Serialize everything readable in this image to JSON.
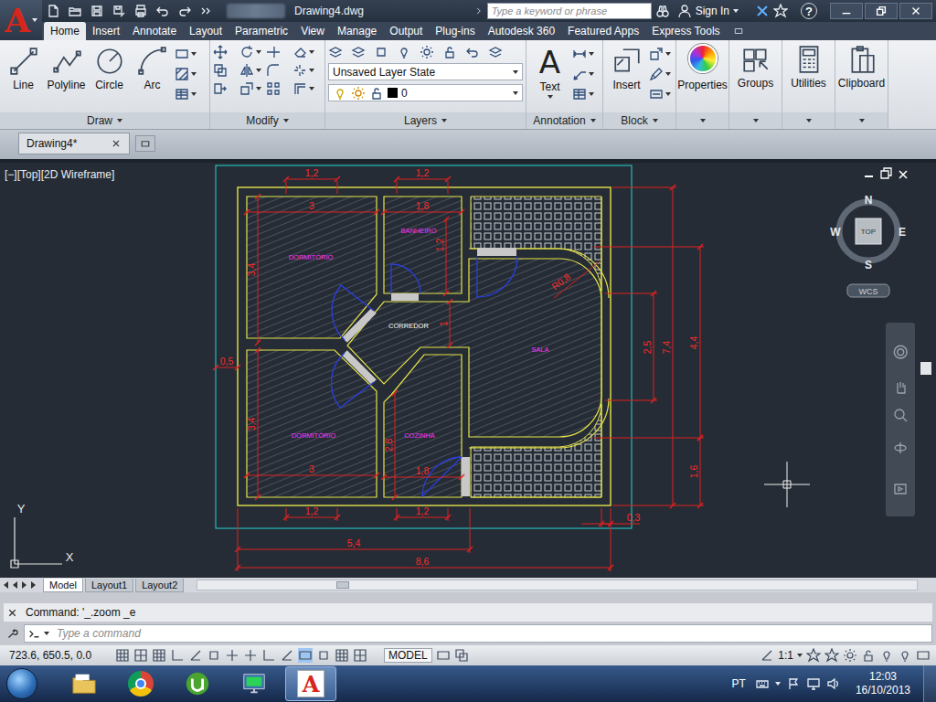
{
  "app": {
    "logo": "A",
    "title": "Drawing4.dwg",
    "search_placeholder": "Type a keyword or phrase",
    "sign_in": "Sign In",
    "help": "?"
  },
  "ribbon_tabs": [
    {
      "label": "Home",
      "selected": true
    },
    {
      "label": "Insert",
      "selected": false
    },
    {
      "label": "Annotate",
      "selected": false
    },
    {
      "label": "Layout",
      "selected": false
    },
    {
      "label": "Parametric",
      "selected": false
    },
    {
      "label": "View",
      "selected": false
    },
    {
      "label": "Manage",
      "selected": false
    },
    {
      "label": "Output",
      "selected": false
    },
    {
      "label": "Plug-ins",
      "selected": false
    },
    {
      "label": "Autodesk 360",
      "selected": false
    },
    {
      "label": "Featured Apps",
      "selected": false
    },
    {
      "label": "Express Tools",
      "selected": false
    }
  ],
  "ribbon_panels": {
    "draw": {
      "title": "Draw",
      "tools": [
        "Line",
        "Polyline",
        "Circle",
        "Arc"
      ]
    },
    "modify": {
      "title": "Modify"
    },
    "layers": {
      "title": "Layers",
      "layer_state": "Unsaved Layer State",
      "current_layer": "0"
    },
    "annotation": {
      "title": "Annotation",
      "tool": "Text",
      "tool_glyph": "A"
    },
    "block": {
      "title": "Block",
      "tool": "Insert"
    },
    "extras": [
      "Properties",
      "Groups",
      "Utilities",
      "Clipboard"
    ]
  },
  "file_tabs": [
    {
      "label": "Drawing4*",
      "selected": true
    }
  ],
  "viewport": {
    "label": "[−][Top][2D Wireframe]",
    "viewcube": {
      "north": "N",
      "south": "S",
      "east": "E",
      "west": "W",
      "face": "TOP",
      "ucs": "WCS"
    },
    "axes": {
      "x": "X",
      "y": "Y"
    }
  },
  "plan": {
    "rooms": [
      {
        "name": "DORMITÓRIO",
        "color": "#ff33ff"
      },
      {
        "name": "BANHEIRO",
        "color": "#ff33ff"
      },
      {
        "name": "CORREDOR",
        "color": "#ffffff"
      },
      {
        "name": "SALA",
        "color": "#ff33ff"
      },
      {
        "name": "DORMITÓRIO",
        "color": "#ff33ff"
      },
      {
        "name": "COZINHA",
        "color": "#ff33ff"
      }
    ],
    "dimensions": [
      "1,2",
      "1,2",
      "3",
      "1,8",
      "3,4",
      "1,2",
      "R0,8",
      "1",
      "0,5",
      "2,5",
      "7,4",
      "4,4",
      "3,4",
      "2,8",
      "1,8",
      "3",
      "1,6",
      "1,2",
      "1,2",
      "0,3",
      "5,4",
      "8,6"
    ]
  },
  "layout_tabs": [
    {
      "label": "Model",
      "selected": true
    },
    {
      "label": "Layout1",
      "selected": false
    },
    {
      "label": "Layout2",
      "selected": false
    }
  ],
  "command_line": {
    "history": "Command: '_.zoom _e",
    "placeholder": "Type a command"
  },
  "status_bar": {
    "coordinates": "723.6, 650.5, 0.0",
    "space": "MODEL",
    "annotation_scale": "1:1"
  },
  "taskbar": {
    "apps": [
      {
        "kind": "explorer",
        "active": false
      },
      {
        "kind": "chrome",
        "active": false
      },
      {
        "kind": "utorrent",
        "active": false
      },
      {
        "kind": "monitor",
        "active": false
      },
      {
        "kind": "autocad",
        "active": true,
        "glyph": "A"
      }
    ],
    "language": "PT",
    "time": "12:03",
    "date": "16/10/2013"
  }
}
